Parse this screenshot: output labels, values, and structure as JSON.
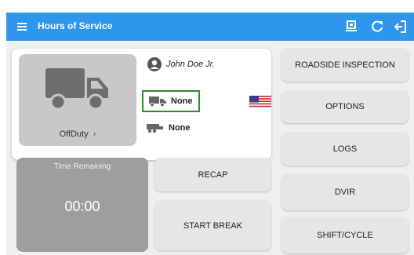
{
  "appbar": {
    "title": "Hours of Service",
    "background": "#2e96ed",
    "icons": [
      "menu-icon",
      "transfer-device-icon",
      "refresh-icon",
      "logout-icon"
    ]
  },
  "driver_card": {
    "status": "OffDuty",
    "status_icon": "truck-icon",
    "driver_name": "John Doe Jr.",
    "vehicle_label": "None",
    "trailer_label": "None",
    "flag": "us-flag-icon",
    "highlight_color": "#2e8b2e"
  },
  "time_remaining": {
    "label": "Time Remaining",
    "value": "00:00"
  },
  "buttons": {
    "recap": "RECAP",
    "start_break": "START BREAK",
    "roadside_inspection": "ROADSIDE INSPECTION",
    "options": "OPTIONS",
    "logs": "LOGS",
    "dvir": "DVIR",
    "shift_cycle": "SHIFT/CYCLE"
  }
}
